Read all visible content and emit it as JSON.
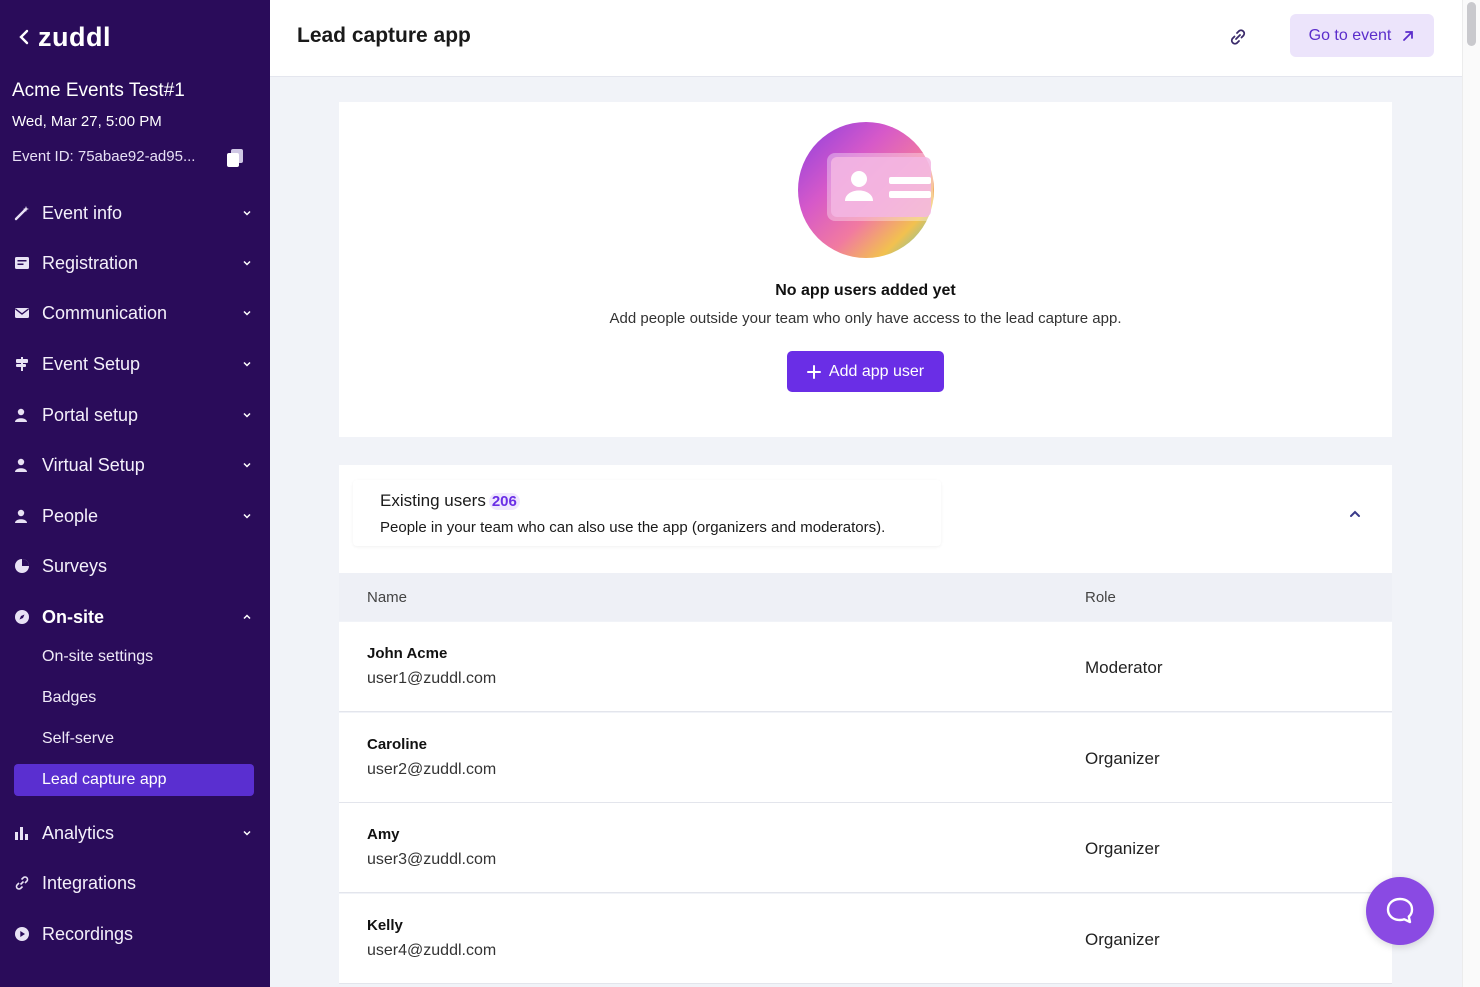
{
  "brand": {
    "logo_text": "zuddl"
  },
  "event": {
    "name": "Acme Events Test#1",
    "date": "Wed, Mar 27, 5:00 PM",
    "id_label": "Event ID: 75abae92-ad95..."
  },
  "sidebar": {
    "items": [
      {
        "label": "Event info",
        "icon": "wand-icon"
      },
      {
        "label": "Registration",
        "icon": "form-icon"
      },
      {
        "label": "Communication",
        "icon": "mail-icon"
      },
      {
        "label": "Event Setup",
        "icon": "signpost-icon"
      },
      {
        "label": "Portal setup",
        "icon": "person-icon"
      },
      {
        "label": "Virtual Setup",
        "icon": "person-icon"
      },
      {
        "label": "People",
        "icon": "person-icon"
      },
      {
        "label": "Surveys",
        "icon": "pie-icon"
      },
      {
        "label": "On-site",
        "icon": "compass-icon"
      },
      {
        "label": "Analytics",
        "icon": "bar-chart-icon"
      },
      {
        "label": "Integrations",
        "icon": "link-icon"
      },
      {
        "label": "Recordings",
        "icon": "play-icon"
      }
    ],
    "onsite_sub": [
      "On-site settings",
      "Badges",
      "Self-serve",
      "Lead capture app"
    ]
  },
  "header": {
    "title": "Lead capture app",
    "go_to_event": "Go to event"
  },
  "empty_state": {
    "title": "No app users added yet",
    "description": "Add people outside your team who only have access to the lead capture app.",
    "add_button": "Add app user"
  },
  "existing_users": {
    "title": "Existing users",
    "count": "206",
    "description": "People in your team who can also use the app (organizers and moderators)."
  },
  "table": {
    "columns": [
      "Name",
      "Role"
    ],
    "rows": [
      {
        "name": "John Acme",
        "email": "user1@zuddl.com",
        "role": "Moderator"
      },
      {
        "name": "Caroline",
        "email": "user2@zuddl.com",
        "role": "Organizer"
      },
      {
        "name": "Amy",
        "email": "user3@zuddl.com",
        "role": "Organizer"
      },
      {
        "name": "Kelly",
        "email": "user4@zuddl.com",
        "role": "Organizer"
      }
    ]
  },
  "colors": {
    "sidebar_bg": "#2a0c5a",
    "accent": "#6a2ee6",
    "active_item": "#5a2fd0"
  }
}
